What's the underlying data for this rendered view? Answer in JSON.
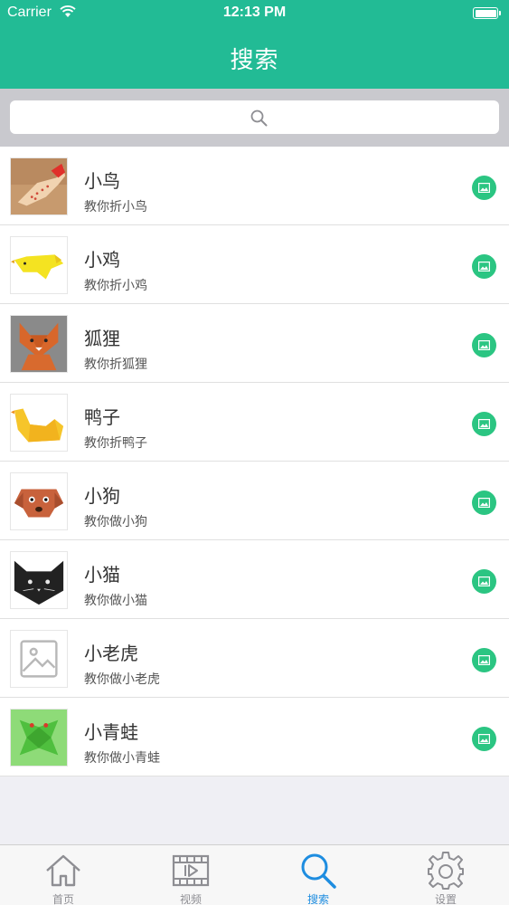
{
  "status_bar": {
    "carrier": "Carrier",
    "time": "12:13 PM"
  },
  "header": {
    "title": "搜索"
  },
  "search": {
    "placeholder": ""
  },
  "items": [
    {
      "title": "小鸟",
      "subtitle": "教你折小鸟",
      "thumb": "bird-thumb"
    },
    {
      "title": "小鸡",
      "subtitle": "教你折小鸡",
      "thumb": "chick-thumb"
    },
    {
      "title": "狐狸",
      "subtitle": "教你折狐狸",
      "thumb": "fox-thumb"
    },
    {
      "title": "鸭子",
      "subtitle": "教你折鸭子",
      "thumb": "duck-thumb"
    },
    {
      "title": "小狗",
      "subtitle": "教你做小狗",
      "thumb": "dog-thumb"
    },
    {
      "title": "小猫",
      "subtitle": "教你做小猫",
      "thumb": "cat-thumb"
    },
    {
      "title": "小老虎",
      "subtitle": "教你做小老虎",
      "thumb": "image-placeholder-icon"
    },
    {
      "title": "小青蛙",
      "subtitle": "教你做小青蛙",
      "thumb": "frog-thumb"
    }
  ],
  "tabs": [
    {
      "label": "首页",
      "icon": "home-icon",
      "active": false
    },
    {
      "label": "视频",
      "icon": "video-icon",
      "active": false
    },
    {
      "label": "搜索",
      "icon": "search-icon",
      "active": true
    },
    {
      "label": "设置",
      "icon": "gear-icon",
      "active": false
    }
  ],
  "colors": {
    "accent": "#22bb95",
    "button": "#2bc582",
    "active_tab": "#1e8de0"
  }
}
